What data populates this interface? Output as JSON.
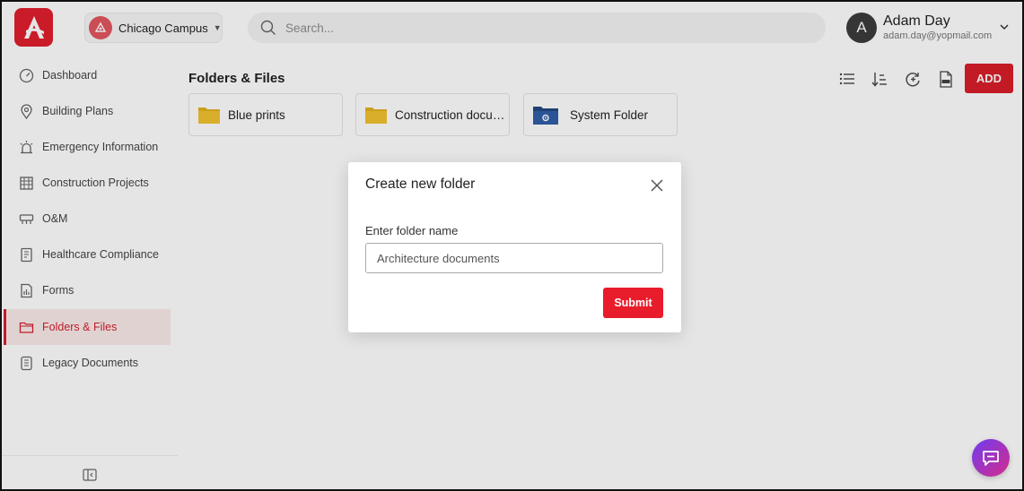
{
  "header": {
    "campus_label": "Chicago Campus",
    "search_placeholder": "Search...",
    "user_initial": "A",
    "user_name": "Adam Day",
    "user_email": "adam.day@yopmail.com"
  },
  "sidebar": {
    "items": [
      {
        "label": "Dashboard",
        "icon": "dashboard-gauge-icon"
      },
      {
        "label": "Building Plans",
        "icon": "map-pin-icon"
      },
      {
        "label": "Emergency Information",
        "icon": "siren-icon"
      },
      {
        "label": "Construction Projects",
        "icon": "building-icon"
      },
      {
        "label": "O&M",
        "icon": "equipment-icon"
      },
      {
        "label": "Healthcare Compliance",
        "icon": "document-icon"
      },
      {
        "label": "Forms",
        "icon": "form-icon"
      },
      {
        "label": "Folders & Files",
        "icon": "folder-icon",
        "active": true
      },
      {
        "label": "Legacy Documents",
        "icon": "legacy-doc-icon"
      }
    ]
  },
  "main": {
    "title": "Folders & Files",
    "add_label": "ADD",
    "folders": [
      {
        "label": "Blue prints",
        "icon": "folder-yellow-icon"
      },
      {
        "label": "Construction documents",
        "icon": "folder-yellow-icon"
      },
      {
        "label": "System Folder",
        "icon": "system-folder-icon"
      }
    ]
  },
  "modal": {
    "title": "Create new folder",
    "field_label": "Enter folder name",
    "field_value": "Architecture documents",
    "submit_label": "Submit"
  },
  "colors": {
    "brand_red": "#e01f2d",
    "active_bg": "#fbeaea",
    "folder_yellow": "#f2c230",
    "folder_blue": "#2f5ea8"
  }
}
